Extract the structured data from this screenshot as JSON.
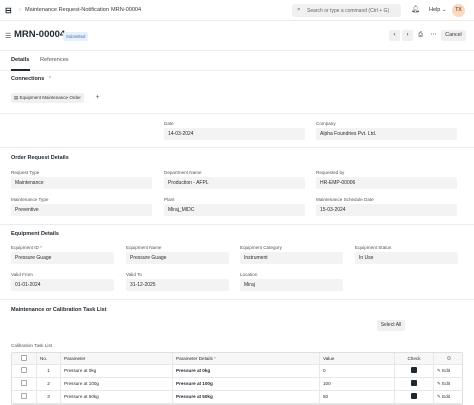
{
  "navbar": {
    "breadcrumbs": [
      "Maintenance Request-Notification",
      "MRN-00004"
    ],
    "search_placeholder": "Search or type a command (Ctrl + G)",
    "help_label": "Help",
    "avatar_initials": "TX"
  },
  "header": {
    "title": "MRN-00004",
    "status": "Submitted",
    "cancel_label": "Cancel"
  },
  "tabs": [
    {
      "label": "Details",
      "active": true
    },
    {
      "label": "References",
      "active": false
    }
  ],
  "connections": {
    "title": "Connections",
    "link_label": "Equipment Maintenance Order"
  },
  "fields_top": {
    "date_label": "Date",
    "date": "14-03-2024",
    "company_label": "Company",
    "company": "Alpha Foundries Pvt. Ltd."
  },
  "order_request": {
    "title": "Order Request Details",
    "request_type_label": "Request Type",
    "request_type": "Maintenance",
    "department_label": "Department Name",
    "department": "Production - AFPL",
    "requested_by_label": "Requested by",
    "requested_by": "HR-EMP-00006",
    "maintenance_type_label": "Maintenance Type",
    "maintenance_type": "Preventive",
    "plant_label": "Plant",
    "plant": "Miraj_MIDC",
    "schedule_date_label": "Maintenance Schedule Date",
    "schedule_date": "15-03-2024"
  },
  "equipment": {
    "title": "Equipment Details",
    "id_label": "Equipment ID",
    "id": "Pressure Guage",
    "name_label": "Equipment Name",
    "name": "Pressure Guage",
    "category_label": "Equipment Category",
    "category": "Instrument",
    "status_label": "Equipment Status",
    "status": "In Use",
    "valid_from_label": "Valid From",
    "valid_from": "01-01-2024",
    "valid_to_label": "Valid To",
    "valid_to": "31-12-2025",
    "location_label": "Location",
    "location": "Miraj"
  },
  "task_list": {
    "title": "Maintenance or Calibration Task List",
    "select_all": "Select All",
    "caption": "Calibration Task List",
    "columns": {
      "no": "No.",
      "parameter": "Parameter",
      "details": "Parameter Details",
      "value": "Value",
      "check": "Check"
    },
    "edit_label": "Edit",
    "rows": [
      {
        "no": "1",
        "parameter": "Pressure at 0kg",
        "details": "Pressure at 0kg",
        "value": "0"
      },
      {
        "no": "2",
        "parameter": "Pressure at 100g",
        "details": "Pressure at 100g",
        "value": "100"
      },
      {
        "no": "3",
        "parameter": "Pressure at 50kg",
        "details": "Pressure at 50kg",
        "value": "50"
      }
    ]
  },
  "colors": {
    "accent": "#1f272e",
    "status_bg": "#e7f0fd",
    "status_text": "#3b6fb6"
  }
}
